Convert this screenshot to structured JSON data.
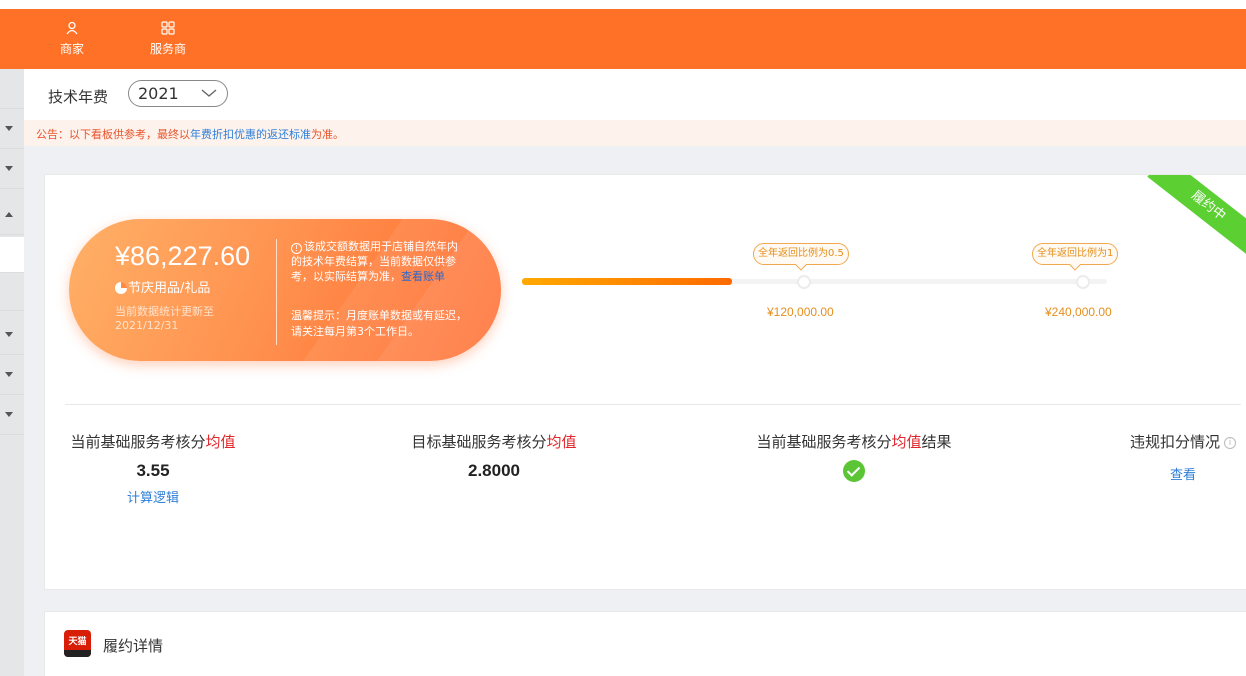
{
  "header": {
    "nav": [
      {
        "label": "商家",
        "icon": "user-icon"
      },
      {
        "label": "服务商",
        "icon": "grid-icon"
      }
    ],
    "accent": "#ff7126"
  },
  "yearbar": {
    "label": "技术年费",
    "year": "2021"
  },
  "notice": {
    "prefix": "公告：以下看板供参考，最终以",
    "highlight": "年费折扣优惠的返还标准",
    "suffix": "为准。"
  },
  "summary": {
    "ribbon": "履约中",
    "amount": "¥86,227.60",
    "category": "节庆用品/礼品",
    "update_label": "当前数据统计更新至",
    "update_date": "2021/12/31",
    "note_text": "该成交额数据用于店铺自然年内的技术年费结算，当前数据仅供参考，以实际结算为准，",
    "note_link": "查看账单",
    "tip_text": "温馨提示：月度账单数据或有延迟，请关注每月第3个工作日。"
  },
  "progress": {
    "fraction": 0.359,
    "milestones": [
      {
        "tip": "全年返回比例为0.5",
        "value": "¥120,000.00"
      },
      {
        "tip": "全年返回比例为1",
        "value": "¥240,000.00"
      }
    ]
  },
  "metrics": {
    "current": {
      "pre": "当前基础服务考核分",
      "red": "均值",
      "post": "",
      "value": "3.55",
      "link": "计算逻辑"
    },
    "target": {
      "pre": "目标基础服务考核分",
      "red": "均值",
      "post": "",
      "value": "2.8000"
    },
    "result": {
      "pre": "当前基础服务考核分",
      "red": "均值",
      "post": "结果",
      "status": "passed"
    },
    "violation": {
      "title": "违规扣分情况",
      "link": "查看"
    }
  },
  "details": {
    "logo_text": "天猫",
    "title": "履约详情"
  }
}
